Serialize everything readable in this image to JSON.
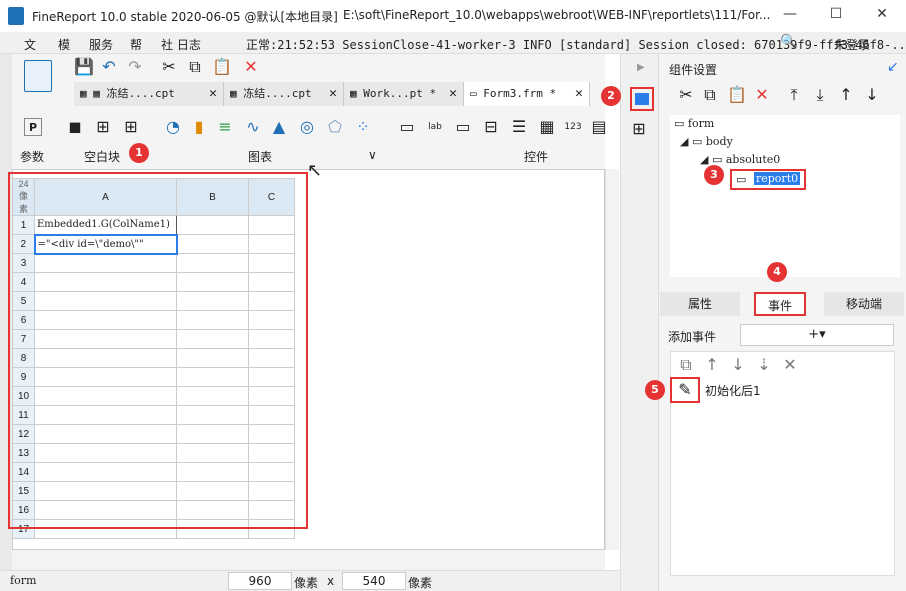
{
  "titlebar": {
    "title": "FineReport 10.0 stable 2020-06-05 @默认[本地目录]",
    "path": "E:\\soft\\FineReport_10.0\\webapps\\webroot\\WEB-INF\\reportlets\\111/For...",
    "minimize": "—",
    "maximize": "☐",
    "close": "✕"
  },
  "menu": {
    "items": [
      "文",
      "模",
      "服务",
      "帮",
      "社 日志"
    ],
    "log": "正常:21:52:53 SessionClose-41-worker-3 INFO [standard] Session closed: 670139f9-fff3-46f8-...",
    "login": "未登录"
  },
  "tabs": [
    {
      "label": "冻结....cpt",
      "close": "✕"
    },
    {
      "label": "冻结....cpt",
      "close": "✕"
    },
    {
      "label": "Work...pt *",
      "close": "✕"
    },
    {
      "label": "Form3.frm *",
      "close": "✕"
    }
  ],
  "toolbar": {
    "section_params": "参数",
    "section_blank": "空白块",
    "section_chart": "图表",
    "section_widgets": "控件",
    "chevron": "∨"
  },
  "sheet": {
    "corner": "24像素",
    "columns": [
      "A",
      "B",
      "C"
    ],
    "rows": [
      "1",
      "2",
      "3",
      "4",
      "5",
      "6",
      "7",
      "8",
      "9",
      "10",
      "11",
      "12",
      "13",
      "14",
      "15",
      "16",
      "17"
    ],
    "cells": {
      "a1": "Embedded1.G(ColName1)",
      "a2": "=\"<div id=\\\"demo\\\"\""
    }
  },
  "status": {
    "form": "form",
    "width": "960",
    "px1": "像素",
    "x": "x",
    "height": "540",
    "px2": "像素"
  },
  "panel": {
    "title": "组件设置",
    "tree": {
      "form": "form",
      "body": "body",
      "absolute": "absolute0",
      "report": "report0"
    },
    "tabs": [
      "属性",
      "事件",
      "移动端"
    ],
    "add_event_label": "添加事件",
    "add_event_button": "+▾",
    "event_item": "初始化后1"
  },
  "badges": [
    "1",
    "2",
    "3",
    "4",
    "5"
  ],
  "colors": {
    "accent": "#1f6fb5",
    "highlight": "#e53333",
    "selection": "#2b7de9"
  }
}
